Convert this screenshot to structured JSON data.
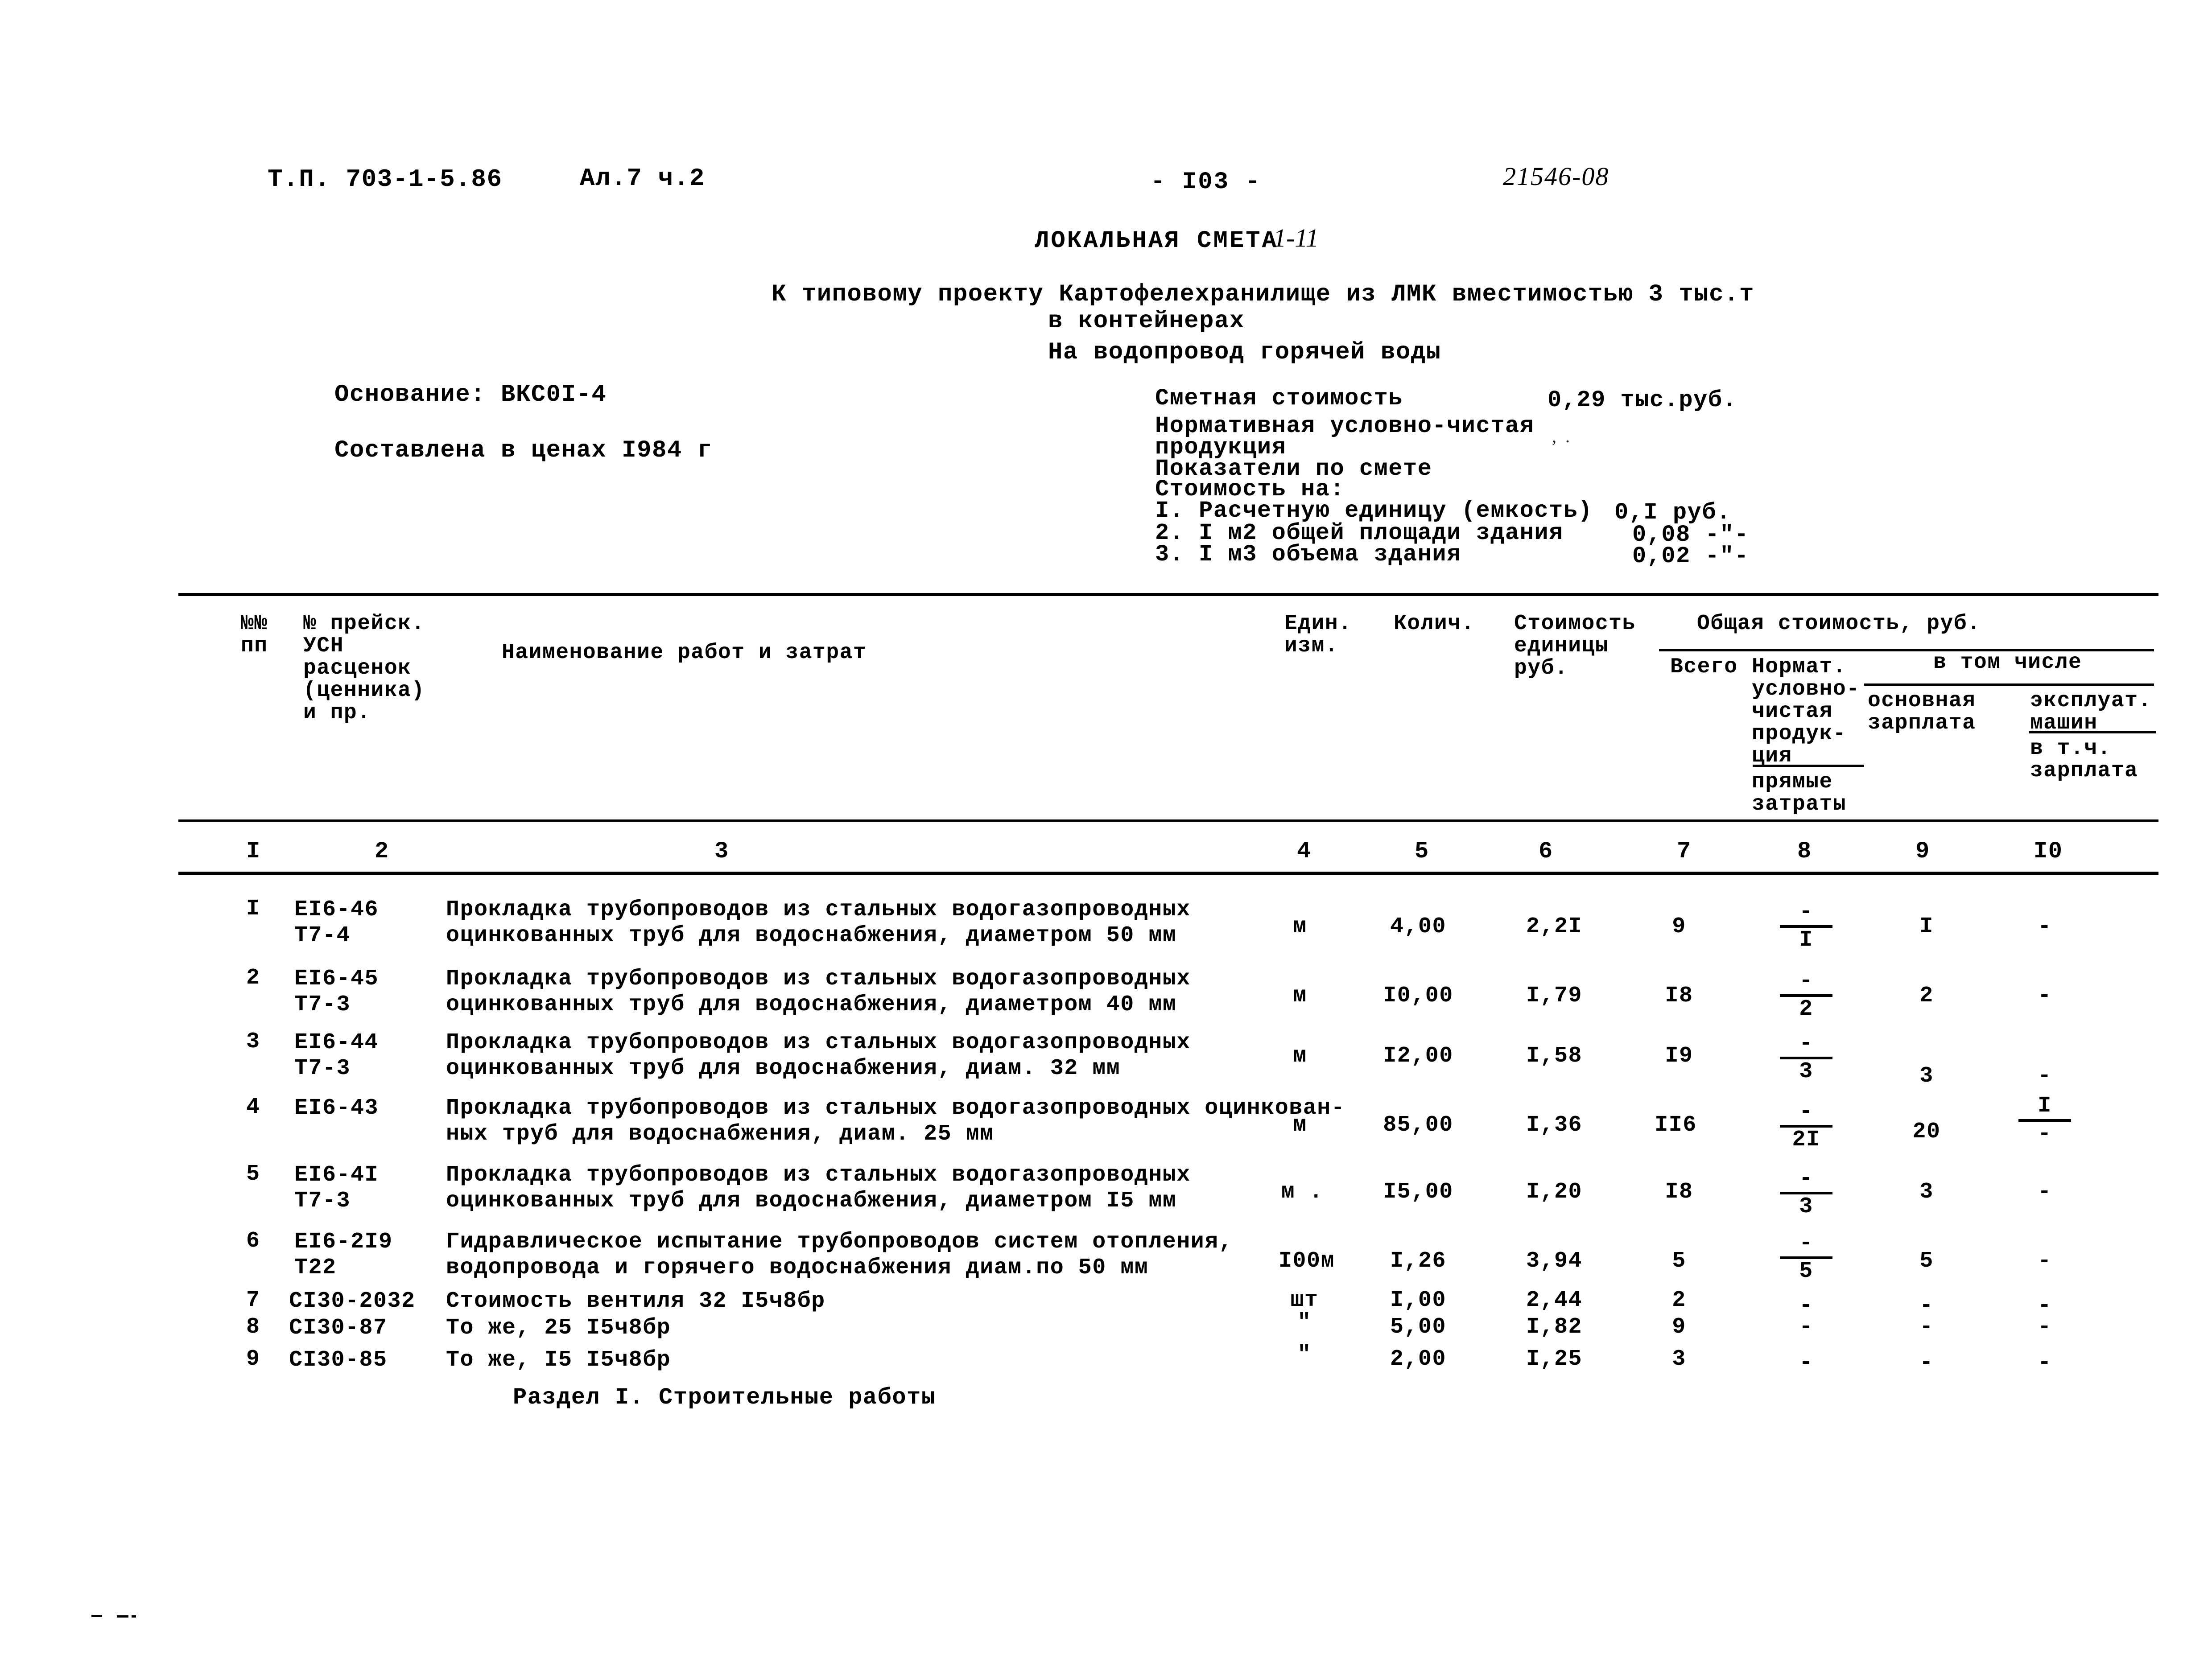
{
  "header": {
    "project_code": "Т.П. 703-1-5.86",
    "album": "Ал.7 ч.2",
    "page_number": "- I03 -",
    "doc_number": "21546-08"
  },
  "title": {
    "main": "ЛОКАЛЬНАЯ СМЕТА",
    "number": "1-11",
    "line_project": "К типовому проекту Картофелехранилище из ЛМК вместимостью 3 тыс.т",
    "line_project_cont": "в контейнерах",
    "line_subject": "На водопровод горячей воды"
  },
  "left_info": {
    "basis_label": "Основание: ВКС0I-4",
    "prices_label": "Составлена в ценах I984 г"
  },
  "right_info": {
    "rows": [
      {
        "label": "Сметная стоимость",
        "value": "0,29 тыс.руб."
      },
      {
        "label": "Нормативная условно-чистая",
        "value": ""
      },
      {
        "label": "продукция",
        "value": ""
      },
      {
        "label": "Показатели по смете",
        "value": ""
      },
      {
        "label": "Стоимость на:",
        "value": ""
      },
      {
        "label": "I. Расчетную единицу (емкость)",
        "value": "0,I руб."
      },
      {
        "label": "2. I м2 общей площади здания",
        "value": "0,08 -\"-"
      },
      {
        "label": "3. I м3 объема здания",
        "value": "0,02 -\"-"
      }
    ]
  },
  "table": {
    "headers": {
      "col1": "№№\nпп",
      "col2": "№ прейск.\nУСН\nрасценок\n(ценника)\nи пр.",
      "col3": "Наименование работ и затрат",
      "col4": "Един.\nизм.",
      "col5": "Колич.",
      "col6": "Стоимость\nединицы\nруб.",
      "group_total": "Общая стоимость, руб.",
      "col7": "Всего",
      "col8": "Нормат.\nусловно-\nчистая\nпродук-\nция",
      "col8b": "прямые\nзатраты",
      "group_incl": "в том числе",
      "col9": "основная\nзарплата",
      "col10": "эксплуат.\nмашин",
      "col10b": "в т.ч.\nзарплата"
    },
    "column_numbers": [
      "I",
      "2",
      "3",
      "4",
      "5",
      "6",
      "7",
      "8",
      "9",
      "I0"
    ],
    "rows": [
      {
        "no": "I",
        "code_line1": "ЕI6-46",
        "code_line2": "Т7-4",
        "desc_line1": "Прокладка трубопроводов из стальных водогазопроводных",
        "desc_line2": "оцинкованных труб для водоснабжения, диаметром 50 мм",
        "unit": "м",
        "qty": "4,00",
        "unit_cost": "2,2I",
        "total": "9",
        "c8_num": "-",
        "c8_den": "I",
        "c9": "I",
        "c10": "-"
      },
      {
        "no": "2",
        "code_line1": "ЕI6-45",
        "code_line2": "Т7-3",
        "desc_line1": "Прокладка трубопроводов из стальных водогазопроводных",
        "desc_line2": "оцинкованных труб для водоснабжения, диаметром 40 мм",
        "unit": "м",
        "qty": "I0,00",
        "unit_cost": "I,79",
        "total": "I8",
        "c8_num": "-",
        "c8_den": "2",
        "c9": "2",
        "c10": "-"
      },
      {
        "no": "3",
        "code_line1": "ЕI6-44",
        "code_line2": "Т7-3",
        "desc_line1": "Прокладка трубопроводов из стальных  водогазопроводных",
        "desc_line2": "оцинкованных труб для водоснабжения, диам. 32 мм",
        "unit": "м",
        "qty": "I2,00",
        "unit_cost": "I,58",
        "total": "I9",
        "c8_num": "-",
        "c8_den": "3",
        "c9": "3",
        "c10": "-"
      },
      {
        "no": "4",
        "code_line1": "ЕI6-43",
        "code_line2": "",
        "desc_line1": "Прокладка трубопроводов из стальных водогазопроводных оцинкован-",
        "desc_line2": "ных труб для водоснабжения, диам. 25 мм",
        "unit": "м",
        "qty": "85,00",
        "unit_cost": "I,36",
        "total": "II6",
        "c8_num": "-",
        "c8_den": "2I",
        "c9": "20",
        "c10_num": "I",
        "c10_den": "-"
      },
      {
        "no": "5",
        "code_line1": "ЕI6-4I",
        "code_line2": "Т7-3",
        "desc_line1": "Прокладка трубопроводов из стальных водогазопроводных",
        "desc_line2": "оцинкованных труб для водоснабжения, диаметром I5 мм",
        "unit": "м .",
        "qty": "I5,00",
        "unit_cost": "I,20",
        "total": "I8",
        "c8_num": "-",
        "c8_den": "3",
        "c9": "3",
        "c10": "-"
      },
      {
        "no": "6",
        "code_line1": "ЕI6-2I9",
        "code_line2": "Т22",
        "desc_line1": "Гидравлическое испытание трубопроводов систем отопления,",
        "desc_line2": "водопровода и горячего водоснабжения диам.по 50 мм",
        "unit": "I00м",
        "qty": "I,26",
        "unit_cost": "3,94",
        "total": "5",
        "c8_num": "-",
        "c8_den": "5",
        "c9": "5",
        "c10": "-"
      },
      {
        "no": "7",
        "code_line1": "СI30-2032",
        "code_line2": "",
        "desc_line1": "Стоимость вентиля 32 I5ч8бр",
        "desc_line2": "",
        "unit": "шт",
        "qty": "I,00",
        "unit_cost": "2,44",
        "total": "2",
        "c8": "-",
        "c9": "-",
        "c10": "-"
      },
      {
        "no": "8",
        "code_line1": "СI30-87",
        "code_line2": "",
        "desc_line1": "То же, 25 I5ч8бр",
        "desc_line2": "",
        "unit": "\"",
        "qty": "5,00",
        "unit_cost": "I,82",
        "total": "9",
        "c8": "-",
        "c9": "-",
        "c10": "-"
      },
      {
        "no": "9",
        "code_line1": "СI30-85",
        "code_line2": "",
        "desc_line1": "То же, I5 I5ч8бр",
        "desc_line2": "",
        "unit": "\"",
        "qty": "2,00",
        "unit_cost": "I,25",
        "total": "3",
        "c8": "-",
        "c9": "-",
        "c10": "-"
      }
    ],
    "section_label": "Раздел I. Строительные работы"
  }
}
